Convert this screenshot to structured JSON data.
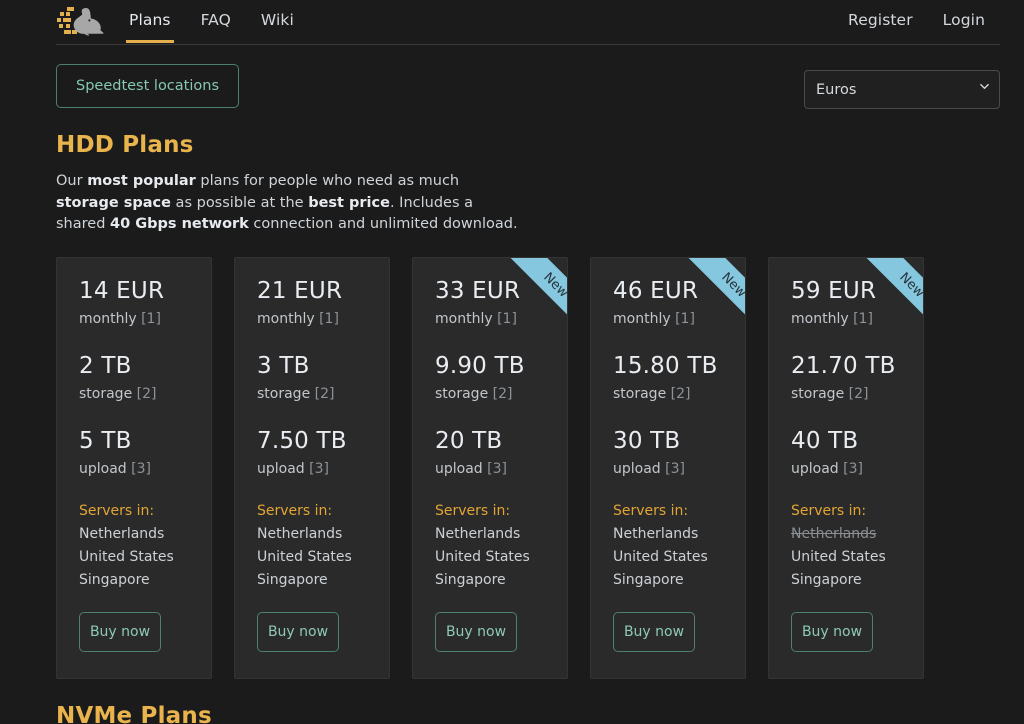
{
  "header": {
    "logo_icon": "rabbit-logo-icon",
    "nav_left": [
      {
        "label": "Plans",
        "active": true
      },
      {
        "label": "FAQ",
        "active": false
      },
      {
        "label": "Wiki",
        "active": false
      }
    ],
    "nav_right": [
      {
        "label": "Register"
      },
      {
        "label": "Login"
      }
    ]
  },
  "toolbar": {
    "speedtest_label": "Speedtest locations",
    "currency_selected": "Euros",
    "currency_options": [
      "Euros"
    ],
    "chevron_icon": "chevron-down-icon"
  },
  "hdd_section": {
    "title": "HDD Plans",
    "desc_parts": [
      {
        "text": "Our ",
        "bold": false
      },
      {
        "text": "most popular",
        "bold": true
      },
      {
        "text": " plans for people who need as much ",
        "bold": false
      },
      {
        "text": "storage space",
        "bold": true
      },
      {
        "text": " as possible at the ",
        "bold": false
      },
      {
        "text": "best price",
        "bold": true
      },
      {
        "text": ". Includes a shared ",
        "bold": false
      },
      {
        "text": "40 Gbps network",
        "bold": true
      },
      {
        "text": " connection and unlimited download.",
        "bold": false
      }
    ],
    "labels": {
      "monthly": "monthly",
      "monthly_ref": "[1]",
      "storage": "storage",
      "storage_ref": "[2]",
      "upload": "upload",
      "upload_ref": "[3]",
      "servers_in": "Servers in:",
      "buy": "Buy now",
      "ribbon": "New"
    },
    "plans": [
      {
        "price": "14 EUR",
        "storage": "2 TB",
        "upload": "5 TB",
        "new": false,
        "servers": [
          {
            "name": "Netherlands",
            "soldout": false
          },
          {
            "name": "United States",
            "soldout": false
          },
          {
            "name": "Singapore",
            "soldout": false
          }
        ]
      },
      {
        "price": "21 EUR",
        "storage": "3 TB",
        "upload": "7.50 TB",
        "new": false,
        "servers": [
          {
            "name": "Netherlands",
            "soldout": false
          },
          {
            "name": "United States",
            "soldout": false
          },
          {
            "name": "Singapore",
            "soldout": false
          }
        ]
      },
      {
        "price": "33 EUR",
        "storage": "9.90 TB",
        "upload": "20 TB",
        "new": true,
        "servers": [
          {
            "name": "Netherlands",
            "soldout": false
          },
          {
            "name": "United States",
            "soldout": false
          },
          {
            "name": "Singapore",
            "soldout": false
          }
        ]
      },
      {
        "price": "46 EUR",
        "storage": "15.80 TB",
        "upload": "30 TB",
        "new": true,
        "servers": [
          {
            "name": "Netherlands",
            "soldout": false
          },
          {
            "name": "United States",
            "soldout": false
          },
          {
            "name": "Singapore",
            "soldout": false
          }
        ]
      },
      {
        "price": "59 EUR",
        "storage": "21.70 TB",
        "upload": "40 TB",
        "new": true,
        "servers": [
          {
            "name": "Netherlands",
            "soldout": true
          },
          {
            "name": "United States",
            "soldout": false
          },
          {
            "name": "Singapore",
            "soldout": false
          }
        ]
      }
    ]
  },
  "nvme_section": {
    "title": "NVMe Plans"
  },
  "colors": {
    "page_bg": "#1b1b1b",
    "card_bg": "#2a2a2a",
    "accent_gold": "#e9b44c",
    "accent_teal": "#86c7b4",
    "ribbon_blue": "#84c7de",
    "text": "#d8dde2"
  }
}
